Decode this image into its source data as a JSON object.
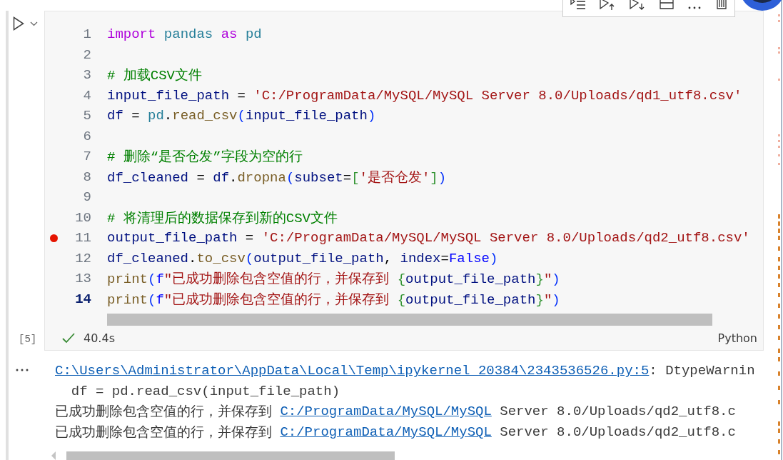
{
  "cell": {
    "execution_count": "[5]",
    "succeeded": true,
    "duration": "40.4s",
    "language": "Python",
    "lines": [
      {
        "number": "1",
        "breakpoint": false,
        "current": false,
        "tokens": [
          {
            "text": "import ",
            "kind": "kw"
          },
          {
            "text": "pandas ",
            "kind": "mod"
          },
          {
            "text": "as ",
            "kind": "kw"
          },
          {
            "text": "pd",
            "kind": "mod"
          }
        ]
      },
      {
        "number": "2",
        "breakpoint": false,
        "current": false
      },
      {
        "number": "3",
        "breakpoint": false,
        "current": false,
        "tokens": [
          {
            "text": "# 加载CSV文件",
            "kind": "com"
          }
        ]
      },
      {
        "number": "4",
        "breakpoint": false,
        "current": false,
        "tokens": [
          {
            "text": "input_file_path",
            "kind": "var"
          },
          {
            "text": " = ",
            "kind": "op"
          },
          {
            "text": "'C:/ProgramData/MySQL/MySQL Server 8.0/Uploads/qd1_utf8.csv'",
            "kind": "str"
          }
        ]
      },
      {
        "number": "5",
        "breakpoint": false,
        "current": false,
        "tokens": [
          {
            "text": "df",
            "kind": "var"
          },
          {
            "text": " = ",
            "kind": "op"
          },
          {
            "text": "pd",
            "kind": "mod"
          },
          {
            "text": ".",
            "kind": "op"
          },
          {
            "text": "read_csv",
            "kind": "fn"
          },
          {
            "text": "(",
            "kind": "b1"
          },
          {
            "text": "input_file_path",
            "kind": "var"
          },
          {
            "text": ")",
            "kind": "b1"
          }
        ]
      },
      {
        "number": "6",
        "breakpoint": false,
        "current": false
      },
      {
        "number": "7",
        "breakpoint": false,
        "current": false,
        "tokens": [
          {
            "text": "# 删除“是否仓发”字段为空的行",
            "kind": "com"
          }
        ]
      },
      {
        "number": "8",
        "breakpoint": false,
        "current": false,
        "tokens": [
          {
            "text": "df_cleaned",
            "kind": "var"
          },
          {
            "text": " = ",
            "kind": "op"
          },
          {
            "text": "df",
            "kind": "var"
          },
          {
            "text": ".",
            "kind": "op"
          },
          {
            "text": "dropna",
            "kind": "fn"
          },
          {
            "text": "(",
            "kind": "b1"
          },
          {
            "text": "subset",
            "kind": "var"
          },
          {
            "text": "=",
            "kind": "op"
          },
          {
            "text": "[",
            "kind": "b2"
          },
          {
            "text": "'是否仓发'",
            "kind": "str"
          },
          {
            "text": "]",
            "kind": "b2"
          },
          {
            "text": ")",
            "kind": "b1"
          }
        ]
      },
      {
        "number": "9",
        "breakpoint": false,
        "current": false
      },
      {
        "number": "10",
        "breakpoint": false,
        "current": false,
        "tokens": [
          {
            "text": "# 将清理后的数据保存到新的CSV文件",
            "kind": "com"
          }
        ]
      },
      {
        "number": "11",
        "breakpoint": true,
        "current": false,
        "tokens": [
          {
            "text": "output_file_path",
            "kind": "var"
          },
          {
            "text": " = ",
            "kind": "op"
          },
          {
            "text": "'C:/ProgramData/MySQL/MySQL Server 8.0/Uploads/qd2_utf8.csv'",
            "kind": "str"
          }
        ]
      },
      {
        "number": "12",
        "breakpoint": false,
        "current": false,
        "tokens": [
          {
            "text": "df_cleaned",
            "kind": "var"
          },
          {
            "text": ".",
            "kind": "op"
          },
          {
            "text": "to_csv",
            "kind": "fn"
          },
          {
            "text": "(",
            "kind": "b1"
          },
          {
            "text": "output_file_path",
            "kind": "var"
          },
          {
            "text": ", ",
            "kind": "op"
          },
          {
            "text": "index",
            "kind": "var"
          },
          {
            "text": "=",
            "kind": "op"
          },
          {
            "text": "False",
            "kind": "const"
          },
          {
            "text": ")",
            "kind": "b1"
          }
        ]
      },
      {
        "number": "13",
        "breakpoint": false,
        "current": false,
        "tokens": [
          {
            "text": "print",
            "kind": "fn"
          },
          {
            "text": "(",
            "kind": "b1"
          },
          {
            "text": "f",
            "kind": "const"
          },
          {
            "text": "\"已成功删除包含空值的行，并保存到 ",
            "kind": "str"
          },
          {
            "text": "{",
            "kind": "b2"
          },
          {
            "text": "output_file_path",
            "kind": "var"
          },
          {
            "text": "}",
            "kind": "b2"
          },
          {
            "text": "\"",
            "kind": "str"
          },
          {
            "text": ")",
            "kind": "b1"
          }
        ]
      },
      {
        "number": "14",
        "breakpoint": false,
        "current": true,
        "tokens": [
          {
            "text": "print",
            "kind": "fn"
          },
          {
            "text": "(",
            "kind": "b1"
          },
          {
            "text": "f",
            "kind": "const"
          },
          {
            "text": "\"已成功删除包含空值的行，并保存到 ",
            "kind": "str"
          },
          {
            "text": "{",
            "kind": "b2"
          },
          {
            "text": "output_file_path",
            "kind": "var"
          },
          {
            "text": "}",
            "kind": "b2"
          },
          {
            "text": "\"",
            "kind": "str"
          },
          {
            "text": ")",
            "kind": "b1"
          }
        ]
      }
    ]
  },
  "output": {
    "lines": [
      {
        "segments": [
          {
            "text": "C:\\Users\\Administrator\\AppData\\Local\\Temp\\ipykernel_20384\\2343536526.py:5",
            "link": true
          },
          {
            "text": ": DtypeWarnin",
            "link": false
          }
        ]
      },
      {
        "segments": [
          {
            "text": "  df = pd.read_csv(input_file_path)",
            "link": false
          }
        ]
      },
      {
        "segments": [
          {
            "text": "已成功删除包含空值的行，并保存到 ",
            "link": false
          },
          {
            "text": "C:/ProgramData/MySQL/MySQL",
            "link": true
          },
          {
            "text": " Server 8.0/Uploads/qd2_utf8.c",
            "link": false
          }
        ]
      },
      {
        "segments": [
          {
            "text": "已成功删除包含空值的行，并保存到 ",
            "link": false
          },
          {
            "text": "C:/ProgramData/MySQL/MySQL",
            "link": true
          },
          {
            "text": " Server 8.0/Uploads/qd2_utf8.c",
            "link": false
          }
        ]
      }
    ]
  }
}
